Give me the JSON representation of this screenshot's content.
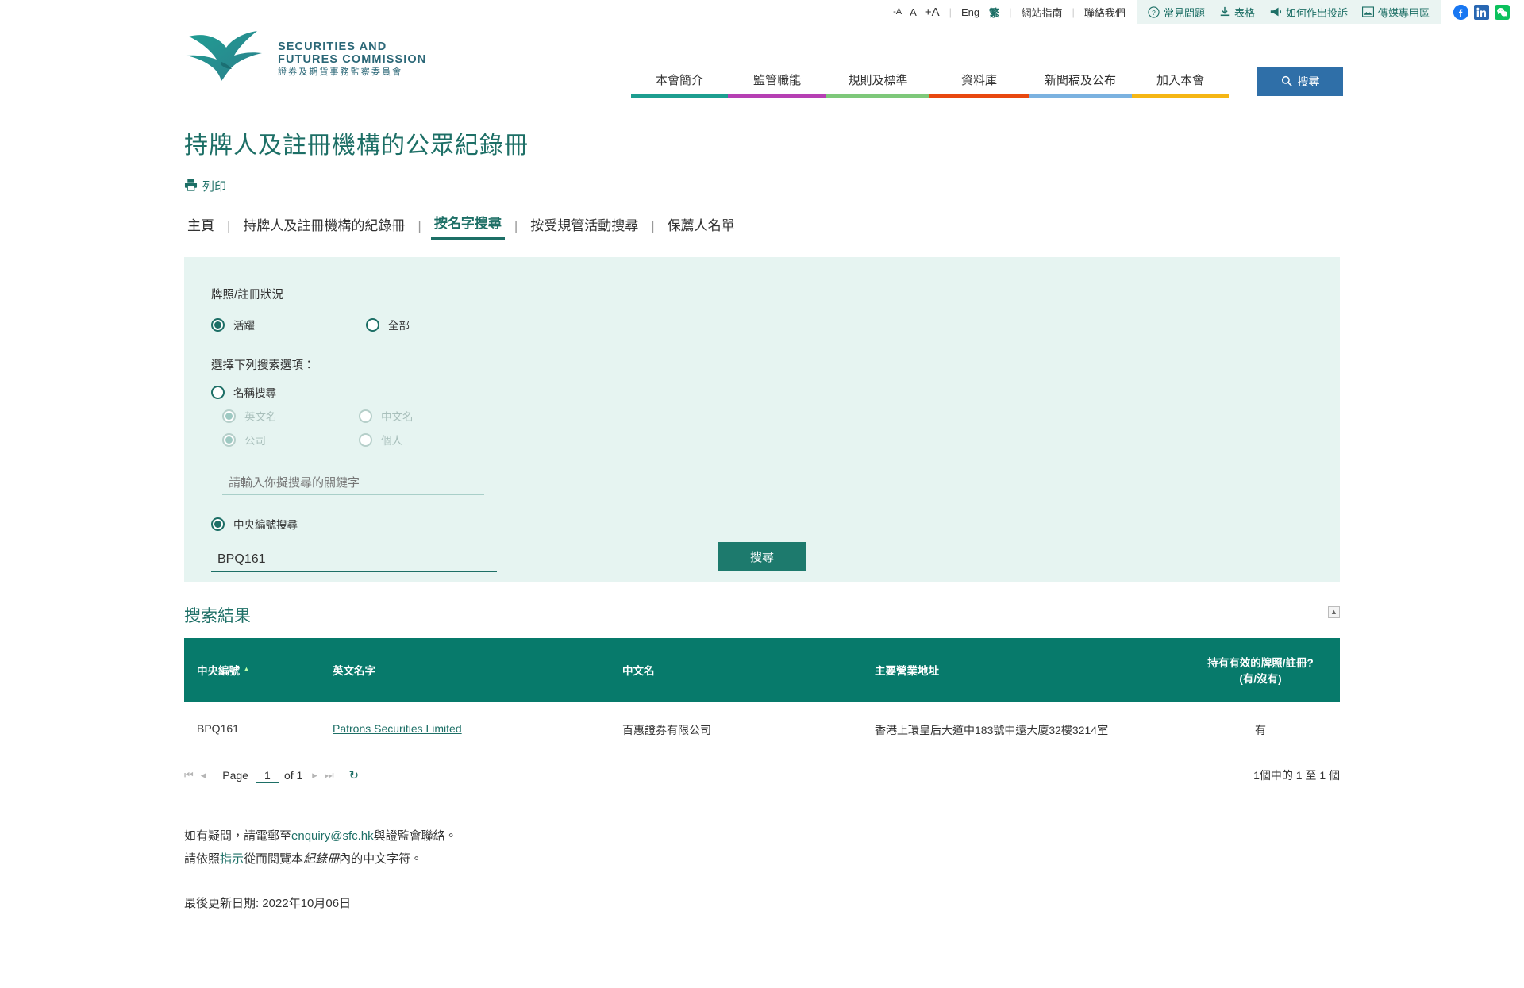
{
  "topbar": {
    "font_size": {
      "decrease": "-A",
      "normal": "A",
      "increase": "+A"
    },
    "lang": {
      "english": "Eng",
      "chinese": "繁"
    },
    "links": [
      {
        "name": "site-map",
        "label": "網站指南"
      },
      {
        "name": "contact-us",
        "label": "聯絡我們"
      }
    ],
    "quick_items": [
      {
        "name": "faq",
        "label": "常見問題",
        "icon": "question-circle-icon"
      },
      {
        "name": "forms",
        "label": "表格",
        "icon": "download-icon"
      },
      {
        "name": "how-to-complain",
        "label": "如何作出投訴",
        "icon": "megaphone-icon"
      },
      {
        "name": "media-zone",
        "label": "傳媒專用區",
        "icon": "image-icon"
      }
    ],
    "social": [
      {
        "name": "facebook",
        "label": "f",
        "color": "#1877F2"
      },
      {
        "name": "linkedin",
        "label": "in",
        "color": "#2867B2"
      },
      {
        "name": "wechat",
        "label": "",
        "color": "#0BC15C"
      }
    ]
  },
  "logo": {
    "line1": "SECURITIES AND",
    "line2": "FUTURES COMMISSION",
    "line3": "證券及期貨事務監察委員會",
    "icon": "sfc-eagle-logo",
    "color": "#2a8f86"
  },
  "nav": {
    "items": [
      {
        "label": "本會簡介",
        "color": "#1d9e90"
      },
      {
        "label": "監管職能",
        "color": "#b63fb3"
      },
      {
        "label": "規則及標準",
        "color": "#7ec87a"
      },
      {
        "label": "資料庫",
        "color": "#e8480f"
      },
      {
        "label": "新聞稿及公布",
        "color": "#7bb2e0"
      },
      {
        "label": "加入本會",
        "color": "#f5b614"
      }
    ],
    "search_button": {
      "label": "搜尋",
      "icon": "search-icon",
      "color": "#2f6fa8"
    }
  },
  "page": {
    "title": "持牌人及註冊機構的公眾紀錄冊",
    "print_label": "列印",
    "print_icon": "printer-icon"
  },
  "tabs": {
    "items": [
      {
        "label": "主頁",
        "active": false
      },
      {
        "label": "持牌人及註冊機構的紀錄冊",
        "active": false
      },
      {
        "label": "按名字搜尋",
        "active": true
      },
      {
        "label": "按受規管活動搜尋",
        "active": false
      },
      {
        "label": "保薦人名單",
        "active": false
      }
    ],
    "divider": "|"
  },
  "search_panel": {
    "status_label": "牌照/註冊狀況",
    "status_options": [
      {
        "label": "活躍",
        "checked": true,
        "disabled": false
      },
      {
        "label": "全部",
        "checked": false,
        "disabled": false
      }
    ],
    "option_label": "選擇下列搜索選項：",
    "name_search": {
      "label": "名稱搜尋",
      "checked": false,
      "disabled": false
    },
    "name_sub_options": [
      {
        "label": "英文名",
        "checked": true,
        "disabled": true
      },
      {
        "label": "中文名",
        "checked": false,
        "disabled": true
      },
      {
        "label": "公司",
        "checked": true,
        "disabled": true
      },
      {
        "label": "個人",
        "checked": false,
        "disabled": true
      }
    ],
    "keyword_input": {
      "value": "",
      "placeholder": "請輸入你擬搜尋的關鍵字"
    },
    "ce_search": {
      "label": "中央編號搜尋",
      "checked": true,
      "disabled": false
    },
    "ce_input": {
      "value": "BPQ161",
      "placeholder": ""
    },
    "submit_label": "搜尋"
  },
  "results": {
    "title": "搜索結果",
    "collapse_icon": "collapse-icon",
    "columns": [
      {
        "label": "中央編號",
        "sorted": true
      },
      {
        "label": "英文名字",
        "sorted": false
      },
      {
        "label": "中文名",
        "sorted": false
      },
      {
        "label": "主要營業地址",
        "sorted": false
      },
      {
        "label": "持有有效的牌照/註冊?\n(有/沒有)",
        "line1": "持有有效的牌照/註冊?",
        "line2": "(有/沒有)",
        "sorted": false
      }
    ],
    "rows": [
      {
        "ce_number": "BPQ161",
        "english_name": "Patrons Securities Limited",
        "chinese_name": "百惠證券有限公司",
        "address": "香港上環皇后大道中183號中遠大廈32樓3214室",
        "valid_licence": "有"
      }
    ],
    "pager": {
      "first_icon": "first-page-icon",
      "prev_icon": "previous-page-icon",
      "page_label": "Page",
      "page_value": "1",
      "of_label": "of 1",
      "next_icon": "next-page-icon",
      "last_icon": "last-page-icon",
      "refresh_icon": "refresh-icon",
      "count_text": "1個中的 1 至 1 個"
    }
  },
  "footer": {
    "line1_pre": "如有疑問，請電郵至",
    "line1_link": "enquiry@sfc.hk",
    "line1_post": "與證監會聯絡。",
    "line2_pre": "請依照",
    "line2_link": "指示",
    "line2_mid": "從而閱覽本",
    "line2_em": "紀錄冊",
    "line2_post": "內的中文字符。",
    "last_update": "最後更新日期: 2022年10月06日"
  }
}
